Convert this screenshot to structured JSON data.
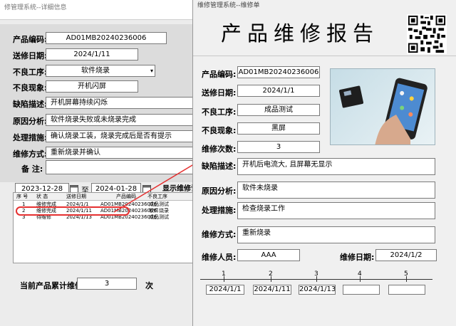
{
  "back_window": {
    "title": "修管理系统--详细信息",
    "fields": [
      {
        "label": "产品编码:",
        "value": "AD01MB20240236006"
      },
      {
        "label": "送修日期:",
        "value": "2024/1/11"
      },
      {
        "label": "不良工序:",
        "value": "软件烧录"
      },
      {
        "label": "不良现象:",
        "value": "开机闪屏"
      },
      {
        "label": "缺陷描述:",
        "value": "开机屏幕持续闪烁"
      },
      {
        "label": "原因分析:",
        "value": "软件烧录失败或未烧录完成"
      },
      {
        "label": "处理措施:",
        "value": "确认烧录工装，烧录完成后是否有提示"
      },
      {
        "label": "维修方式:",
        "value": "重新烧录并确认"
      },
      {
        "label": "备  注:",
        "value": ""
      }
    ],
    "date_from": "2023-12-28",
    "date_to_label": "至",
    "date_to": "2024-01-28",
    "show_button": "显示维修记",
    "list": {
      "headers": [
        "序 号",
        "状 态",
        "送修日期",
        "产品编码",
        "不良工序"
      ],
      "rows": [
        [
          "1",
          "维修完成",
          "2024/1/1",
          "AD01MB20240236006",
          "成品测试"
        ],
        [
          "2",
          "维修完成",
          "2024/1/11",
          "AD01MB20240236006",
          "软件烧录"
        ],
        [
          "3",
          "待维修",
          "2024/1/13",
          "AD01MB20240236006",
          "成品测试"
        ]
      ]
    },
    "total_label": "当前产品累计维修:",
    "total_value": "3",
    "total_unit": "次"
  },
  "front_window": {
    "title": "维修管理系统--维修单",
    "report_title": "产品维修报告",
    "fields": {
      "code": {
        "label": "产品编码:",
        "value": "AD01MB20240236006"
      },
      "date": {
        "label": "送修日期:",
        "value": "2024/1/1"
      },
      "process": {
        "label": "不良工序:",
        "value": "成品测试"
      },
      "symptom": {
        "label": "不良现象:",
        "value": "黑屏"
      },
      "count": {
        "label": "维修次数:",
        "value": "3"
      },
      "defect": {
        "label": "缺陷描述:",
        "value": "开机后电流大, 且屏幕无显示"
      },
      "cause": {
        "label": "原因分析:",
        "value": "软件未烧录"
      },
      "action": {
        "label": "处理措施:",
        "value": "检查烧录工作"
      },
      "method": {
        "label": "维修方式:",
        "value": "重新烧录"
      },
      "repairer": {
        "label": "维修人员:",
        "value": "AAA"
      },
      "repair_date": {
        "label": "维修日期:",
        "value": "2024/1/2"
      }
    },
    "timeline": {
      "numbers": [
        "1",
        "2",
        "3",
        "4",
        "5"
      ],
      "dates": [
        "2024/1/1",
        "2024/1/11",
        "2024/1/13",
        "",
        ""
      ]
    }
  },
  "colors": {
    "highlight": "#e53030",
    "arrow": "#e53030"
  },
  "icons": [
    "calendar-icon",
    "dropdown-arrow-icon",
    "qr-code-icon",
    "product-photo"
  ]
}
